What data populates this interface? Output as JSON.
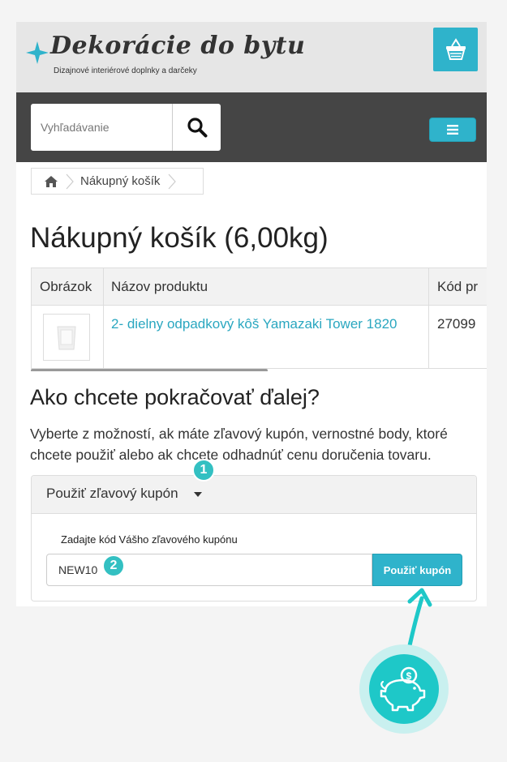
{
  "header": {
    "logo_title": "Dekorácie do bytu",
    "logo_tagline": "Dizajnové interiérové doplnky a darčeky",
    "cart_icon": "basket-icon"
  },
  "toolbar": {
    "search_placeholder": "Vyhľadávanie",
    "search_icon": "search-icon",
    "menu_icon": "hamburger-icon"
  },
  "breadcrumb": {
    "home_icon": "home-icon",
    "items": [
      "Nákupný košík"
    ]
  },
  "page": {
    "title": "Nákupný košík  (6,00kg)"
  },
  "cart_table": {
    "headers": [
      "Obrázok",
      "Názov produktu",
      "Kód pr"
    ],
    "rows": [
      {
        "product_name": "2- dielny odpadkový kôš Yamazaki Tower 1820",
        "code": "27099"
      }
    ]
  },
  "continue_section": {
    "heading": "Ako chcete pokračovať ďalej?",
    "description": "Vyberte z možností, ak máte zľavový kupón, vernostné body, ktoré chcete použiť alebo ak chcete odhadnúť cenu doručenia tovaru."
  },
  "coupon_panel": {
    "title": "Použiť zľavový kupón",
    "label": "Zadajte kód Vášho zľavového kupónu",
    "input_value": "NEW10",
    "button_label": "Použiť kupón"
  },
  "annotations": {
    "step1": "1",
    "step2": "2",
    "accent_color": "#33c0c2",
    "decoration_icon": "piggy-bank-icon"
  },
  "colors": {
    "brand": "#2fb3cb",
    "dark_bar": "#454545",
    "link": "#2aa7c0"
  }
}
